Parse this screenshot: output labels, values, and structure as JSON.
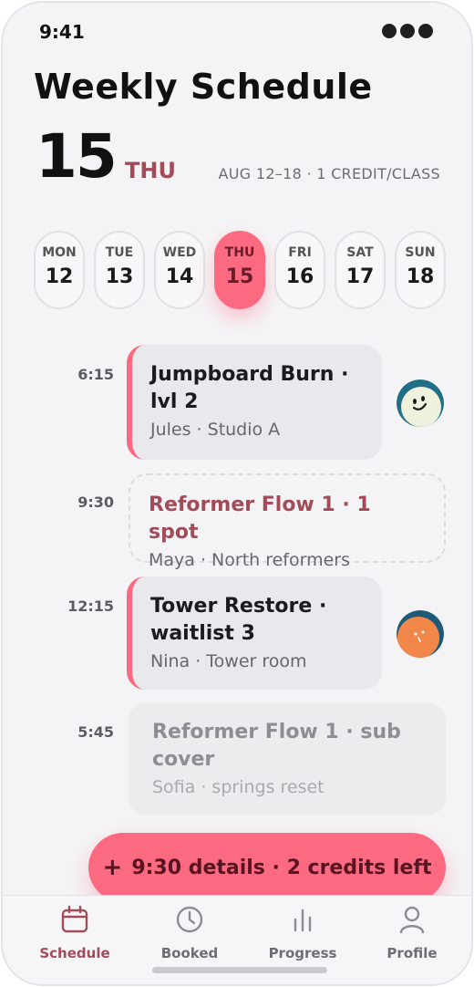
{
  "status": {
    "time": "9:41"
  },
  "header": {
    "title": "Weekly Schedule",
    "day_number": "15",
    "day_name": "THU",
    "range": "AUG 12–18 · 1 CREDIT/CLASS"
  },
  "days": [
    {
      "dow": "MON",
      "num": "12"
    },
    {
      "dow": "TUE",
      "num": "13"
    },
    {
      "dow": "WED",
      "num": "14"
    },
    {
      "dow": "THU",
      "num": "15"
    },
    {
      "dow": "FRI",
      "num": "16"
    },
    {
      "dow": "SAT",
      "num": "17"
    },
    {
      "dow": "SUN",
      "num": "18"
    }
  ],
  "classes": [
    {
      "time": "6:15",
      "title": "Jumpboard Burn · lvl 2",
      "sub": "Jules · Studio A"
    },
    {
      "time": "9:30",
      "title": "Reformer Flow 1 · 1 spot",
      "sub": "Maya · North reformers"
    },
    {
      "time": "12:15",
      "title": "Tower Restore · waitlist 3",
      "sub": "Nina · Tower room"
    },
    {
      "time": "5:45",
      "title": "Reformer Flow 1 · sub cover",
      "sub": "Sofia · springs reset"
    }
  ],
  "cta": {
    "label": "9:30 details · 2 credits left"
  },
  "tabs": [
    {
      "label": "Schedule",
      "icon": "calendar-icon"
    },
    {
      "label": "Booked",
      "icon": "clock-icon"
    },
    {
      "label": "Progress",
      "icon": "chart-icon"
    },
    {
      "label": "Profile",
      "icon": "person-icon"
    }
  ],
  "colors": {
    "accent": "#fb6a80",
    "accent_text": "#a24c5a",
    "background": "#f4f4f6"
  }
}
